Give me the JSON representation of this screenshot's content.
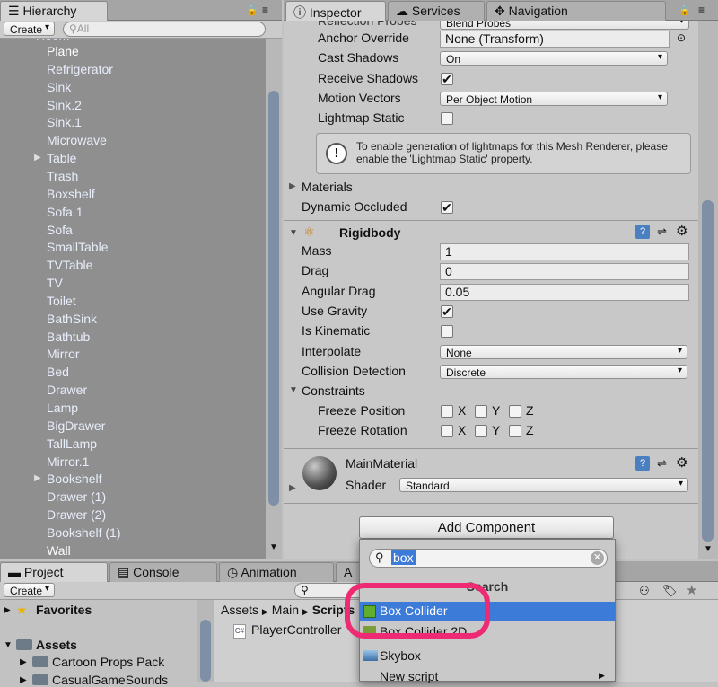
{
  "hierarchy": {
    "tab": "Hierarchy",
    "create": "Create",
    "search_placeholder": "All",
    "items": [
      {
        "label": "Plane",
        "expand": false,
        "active": true
      },
      {
        "label": "Refrigerator",
        "expand": false,
        "active": false
      },
      {
        "label": "Sink",
        "expand": false,
        "active": false
      },
      {
        "label": "Sink.2",
        "expand": false,
        "active": false
      },
      {
        "label": "Sink.1",
        "expand": false,
        "active": false
      },
      {
        "label": "Microwave",
        "expand": false,
        "active": false
      },
      {
        "label": "Table",
        "expand": true,
        "active": false
      },
      {
        "label": "Trash",
        "expand": false,
        "active": false
      },
      {
        "label": "Boxshelf",
        "expand": false,
        "active": false
      },
      {
        "label": "Sofa.1",
        "expand": false,
        "active": false
      },
      {
        "label": "Sofa",
        "expand": false,
        "active": false
      },
      {
        "label": "SmallTable",
        "expand": false,
        "active": false
      },
      {
        "label": "TVTable",
        "expand": false,
        "active": false
      },
      {
        "label": "TV",
        "expand": false,
        "active": false
      },
      {
        "label": "Toilet",
        "expand": false,
        "active": false
      },
      {
        "label": "BathSink",
        "expand": false,
        "active": false
      },
      {
        "label": "Bathtub",
        "expand": false,
        "active": false
      },
      {
        "label": "Mirror",
        "expand": false,
        "active": false
      },
      {
        "label": "Bed",
        "expand": false,
        "active": false
      },
      {
        "label": "Drawer",
        "expand": false,
        "active": false
      },
      {
        "label": "Lamp",
        "expand": false,
        "active": false
      },
      {
        "label": "BigDrawer",
        "expand": false,
        "active": false
      },
      {
        "label": "TallLamp",
        "expand": false,
        "active": false
      },
      {
        "label": "Mirror.1",
        "expand": false,
        "active": false
      },
      {
        "label": "Bookshelf",
        "expand": true,
        "active": false
      },
      {
        "label": "Drawer (1)",
        "expand": false,
        "active": false
      },
      {
        "label": "Drawer (2)",
        "expand": false,
        "active": false
      },
      {
        "label": "Bookshelf (1)",
        "expand": false,
        "active": false
      },
      {
        "label": "Wall",
        "expand": false,
        "active": true
      }
    ]
  },
  "inspector": {
    "tabs": [
      "Inspector",
      "Services",
      "Navigation"
    ],
    "mesh_rows": [
      {
        "label": "Anchor Override",
        "type": "field",
        "value": "None (Transform)"
      },
      {
        "label": "Cast Shadows",
        "type": "dropdown",
        "value": "On"
      },
      {
        "label": "Receive Shadows",
        "type": "check",
        "checked": true
      },
      {
        "label": "Motion Vectors",
        "type": "dropdown",
        "value": "Per Object Motion"
      },
      {
        "label": "Lightmap Static",
        "type": "check",
        "checked": false
      }
    ],
    "info_text": "To enable generation of lightmaps for this Mesh Renderer, please enable the 'Lightmap Static' property.",
    "materials_label": "Materials",
    "dynamic_occluded_label": "Dynamic Occluded",
    "rigidbody": {
      "title": "Rigidbody",
      "rows": [
        {
          "label": "Mass",
          "type": "field",
          "value": "1"
        },
        {
          "label": "Drag",
          "type": "field",
          "value": "0"
        },
        {
          "label": "Angular Drag",
          "type": "field",
          "value": "0.05"
        },
        {
          "label": "Use Gravity",
          "type": "check",
          "checked": true
        },
        {
          "label": "Is Kinematic",
          "type": "check",
          "checked": false
        },
        {
          "label": "Interpolate",
          "type": "dropdown",
          "value": "None"
        },
        {
          "label": "Collision Detection",
          "type": "dropdown",
          "value": "Discrete"
        }
      ],
      "constraints_label": "Constraints",
      "freeze_position_label": "Freeze Position",
      "freeze_rotation_label": "Freeze Rotation",
      "axes": [
        "X",
        "Y",
        "Z"
      ]
    },
    "material": {
      "name": "MainMaterial",
      "shader_label": "Shader",
      "shader_value": "Standard"
    },
    "add_component": "Add Component"
  },
  "popup": {
    "search_value": "box",
    "header": "Search",
    "items": [
      "Box Collider",
      "Box Collider 2D",
      "Skybox",
      "New script"
    ]
  },
  "project": {
    "tabs": [
      "Project",
      "Console",
      "Animation"
    ],
    "create": "Create",
    "favorites": "Favorites",
    "assets": "Assets",
    "folders": [
      "Cartoon Props Pack",
      "CasualGameSounds"
    ],
    "breadcrumb": [
      "Assets",
      "Main",
      "Scripts"
    ],
    "file": "PlayerController"
  },
  "colors": {
    "selection": "#3d7bd9",
    "highlight_ring": "#ee2a74",
    "hier_bg": "#8f8f8f",
    "item_text": "#e8eefb"
  }
}
